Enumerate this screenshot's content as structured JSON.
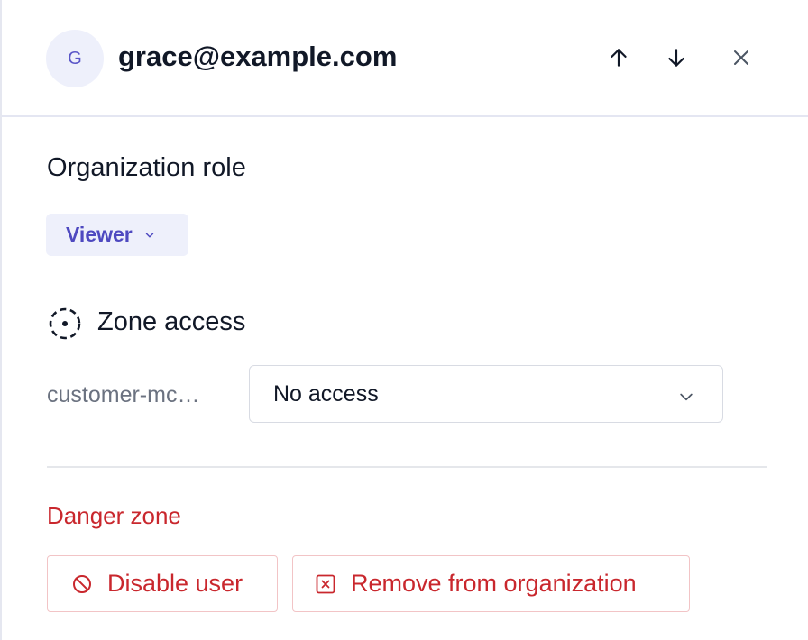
{
  "user": {
    "avatar_initial": "G",
    "email": "grace@example.com"
  },
  "header": {
    "prev_icon": "arrow-up-icon",
    "next_icon": "arrow-down-icon",
    "close_icon": "close-icon"
  },
  "org_role": {
    "title": "Organization role",
    "selected": "Viewer"
  },
  "zone_access": {
    "title": "Zone access",
    "icon": "dashed-circle-icon",
    "zones": [
      {
        "name": "customer-mc…",
        "access": "No access"
      }
    ]
  },
  "danger_zone": {
    "title": "Danger zone",
    "disable_label": "Disable user",
    "remove_label": "Remove from organization"
  },
  "colors": {
    "accent": "#4e49c0",
    "accent_bg": "#eef0fb",
    "danger": "#c9272d",
    "danger_border": "#f2c4c6"
  }
}
